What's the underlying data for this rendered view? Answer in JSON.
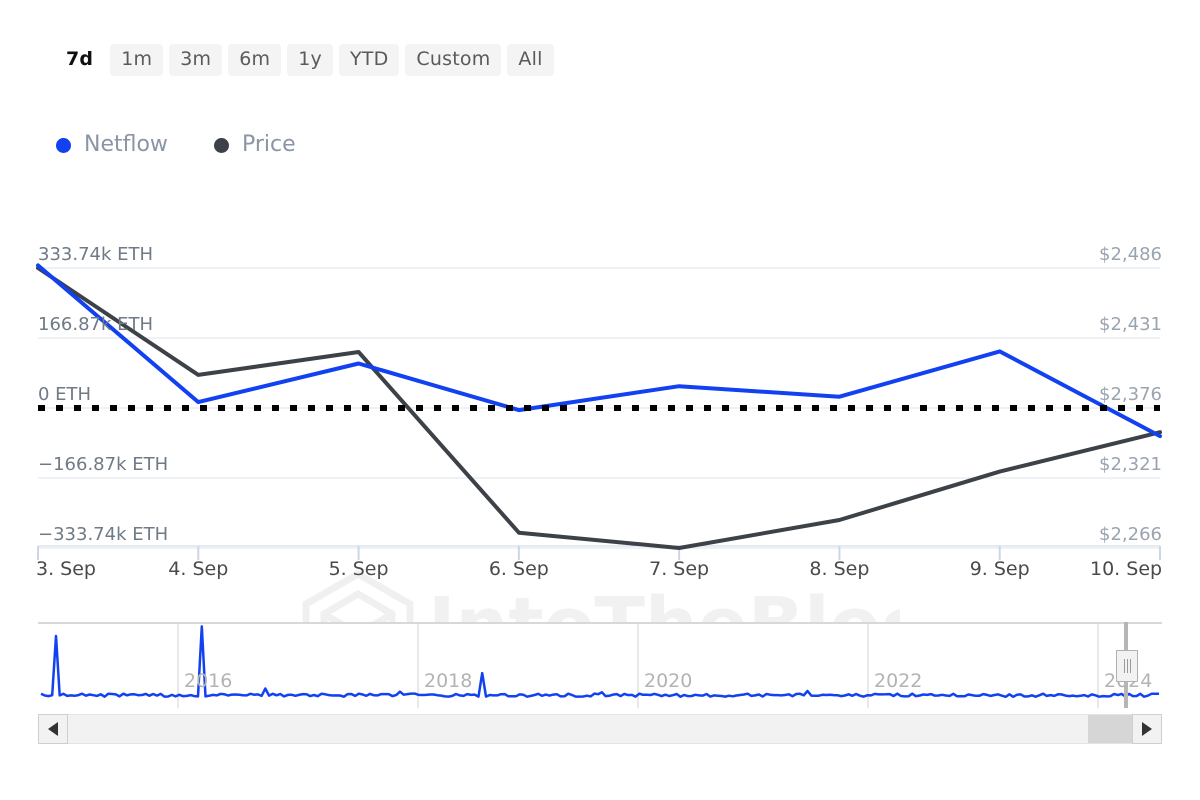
{
  "range_selector": {
    "options": [
      {
        "label": "7d",
        "active": true
      },
      {
        "label": "1m",
        "active": false
      },
      {
        "label": "3m",
        "active": false
      },
      {
        "label": "6m",
        "active": false
      },
      {
        "label": "1y",
        "active": false
      },
      {
        "label": "YTD",
        "active": false
      },
      {
        "label": "Custom",
        "active": false
      },
      {
        "label": "All",
        "active": false
      }
    ]
  },
  "legend": {
    "items": [
      {
        "label": "Netflow",
        "color": "#1141f0",
        "icon": "legend-dot-icon"
      },
      {
        "label": "Price",
        "color": "#3d4148",
        "icon": "legend-dot-icon"
      }
    ]
  },
  "watermark": {
    "text": "IntoTheBlock",
    "logo_icon": "intotheblock-cube-icon",
    "color": "#f1f1f1"
  },
  "navigator": {
    "year_labels": [
      "2016",
      "2018",
      "2020",
      "2022",
      "2024"
    ],
    "series_color": "#1141f0",
    "handle_icon": "navigator-drag-handle-icon"
  },
  "scrollbar": {
    "left_button_icon": "arrow-left-icon",
    "right_button_icon": "arrow-right-icon",
    "thumb_name": "scrollbar-thumb"
  },
  "chart_data": {
    "type": "line",
    "title": "",
    "xlabel": "",
    "grid": true,
    "legend_position": "top-left",
    "x": [
      "3. Sep",
      "4. Sep",
      "5. Sep",
      "6. Sep",
      "7. Sep",
      "8. Sep",
      "9. Sep",
      "10. Sep"
    ],
    "axes": {
      "left": {
        "label": "Netflow",
        "unit": "ETH",
        "ticks": [
          "333.74k ETH",
          "166.87k ETH",
          "0 ETH",
          "-166.87k ETH",
          "-333.74k ETH"
        ],
        "tick_values": [
          333740,
          166870,
          0,
          -166870,
          -333740
        ],
        "ylim": [
          -403000,
          403000
        ],
        "zero_line": true
      },
      "right": {
        "label": "Price",
        "unit": "USD",
        "ticks": [
          "$2,486",
          "$2,431",
          "$2,376",
          "$2,321",
          "$2,266"
        ],
        "tick_values": [
          2486,
          2431,
          2376,
          2321,
          2266
        ],
        "ylim": [
          2223,
          2529
        ]
      }
    },
    "series": [
      {
        "name": "Netflow",
        "axis": "left",
        "color": "#1141f0",
        "unit": "ETH",
        "values": [
          340000,
          14000,
          106000,
          -5000,
          52000,
          27000,
          135000,
          -67000
        ],
        "labels": [
          "340k ETH",
          "14k ETH",
          "106k ETH",
          "-5k ETH",
          "52k ETH",
          "27k ETH",
          "135k ETH",
          "-67k ETH"
        ]
      },
      {
        "name": "Price",
        "axis": "right",
        "color": "#3d4148",
        "unit": "USD",
        "values": [
          2486,
          2402,
          2420,
          2278,
          2266,
          2288,
          2326,
          2357
        ],
        "labels": [
          "$2,486",
          "$2,402",
          "$2,420",
          "$2,278",
          "$2,266",
          "$2,288",
          "$2,326",
          "$2,357"
        ]
      }
    ]
  }
}
